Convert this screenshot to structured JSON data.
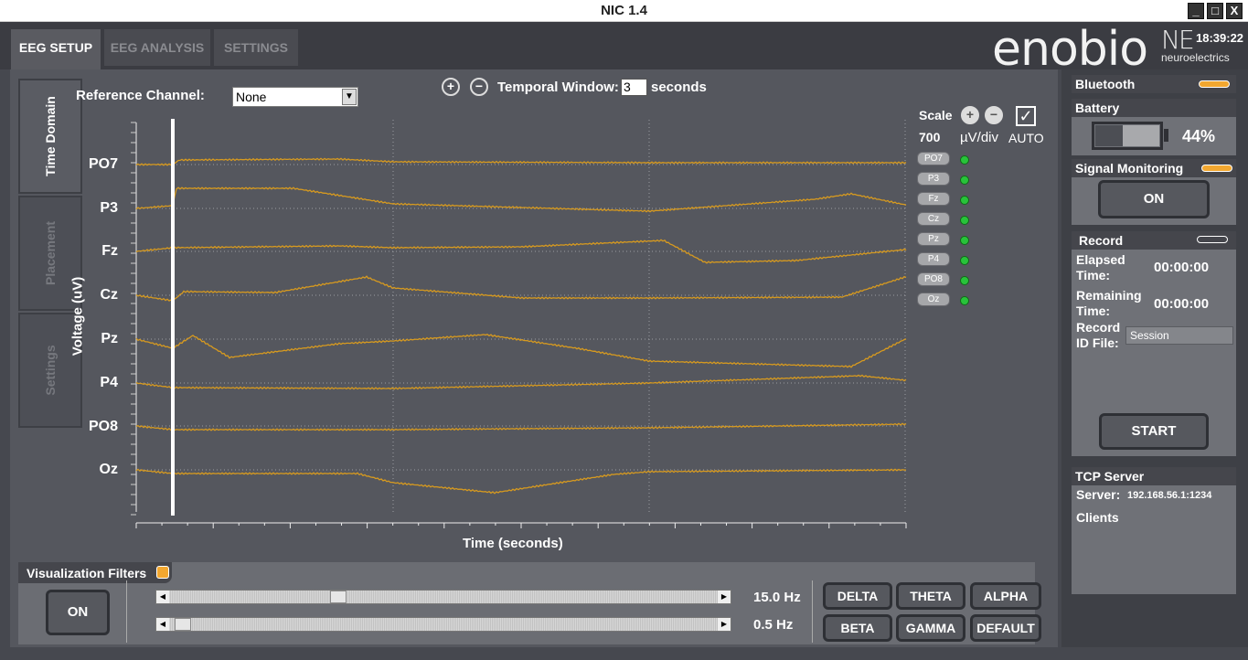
{
  "window": {
    "title": "NIC 1.4",
    "controls": [
      "_",
      "□",
      "X"
    ]
  },
  "header": {
    "tabs": [
      {
        "label": "EEG SETUP",
        "active": true
      },
      {
        "label": "EEG ANALYSIS",
        "active": false
      },
      {
        "label": "SETTINGS",
        "active": false
      }
    ],
    "brand": "enobio",
    "logo_ne": "NE",
    "logo_sub": "neuroelectrics",
    "clock": "18:39:22"
  },
  "side_tabs": [
    {
      "label": "Time Domain",
      "active": true
    },
    {
      "label": "Placement",
      "active": false
    },
    {
      "label": "Settings",
      "active": false
    }
  ],
  "reference": {
    "label": "Reference Channel:",
    "value": "None"
  },
  "temporal": {
    "label": "Temporal Window:",
    "value": "3",
    "unit": "seconds"
  },
  "chart": {
    "ylabel": "Voltage (uV)",
    "xlabel": "Time (seconds)",
    "channels": [
      "PO7",
      "P3",
      "Fz",
      "Cz",
      "Pz",
      "P4",
      "PO8",
      "Oz"
    ],
    "trace_color": "#d79a1f"
  },
  "scale": {
    "label": "Scale",
    "value": "700",
    "unit": "µV/div",
    "auto_label": "AUTO",
    "auto": true
  },
  "channel_status": [
    {
      "name": "PO7",
      "status": "good"
    },
    {
      "name": "P3",
      "status": "good"
    },
    {
      "name": "Fz",
      "status": "good"
    },
    {
      "name": "Cz",
      "status": "good"
    },
    {
      "name": "Pz",
      "status": "good"
    },
    {
      "name": "P4",
      "status": "good"
    },
    {
      "name": "PO8",
      "status": "good"
    },
    {
      "name": "Oz",
      "status": "good"
    }
  ],
  "filters": {
    "title": "Visualization Filters",
    "on_label": "ON",
    "high_hz": "15.0 Hz",
    "low_hz": "0.5 Hz",
    "bands": [
      "DELTA",
      "THETA",
      "ALPHA",
      "BETA",
      "GAMMA",
      "DEFAULT"
    ]
  },
  "right": {
    "bluetooth": "Bluetooth",
    "battery_label": "Battery",
    "battery_pct": "44%",
    "battery_level": 0.44,
    "signal_label": "Signal Monitoring",
    "signal_btn": "ON",
    "record_label": "Record",
    "elapsed_label": "Elapsed Time:",
    "elapsed_val": "00:00:00",
    "remaining_label": "Remaining Time:",
    "remaining_val": "00:00:00",
    "record_id_label": "Record ID File:",
    "record_id_value": "Session",
    "start_btn": "START",
    "tcp_label": "TCP Server",
    "server_label": "Server:",
    "server_value": "192.168.56.1:1234",
    "clients_label": "Clients"
  },
  "colors": {
    "accent": "#f2a730",
    "led_green": "#28c33a",
    "trace": "#d79a1f"
  }
}
